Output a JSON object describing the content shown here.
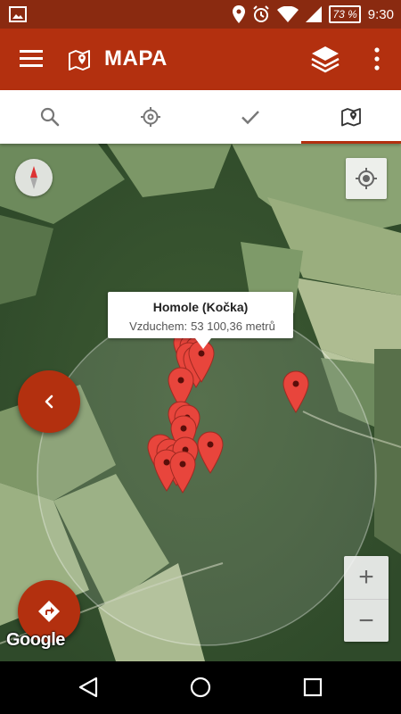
{
  "statusbar": {
    "battery": "73 %",
    "time": "9:30",
    "icons": [
      "image-icon",
      "location-icon",
      "alarm-icon",
      "wifi-icon",
      "signal-icon"
    ]
  },
  "appbar": {
    "title": "MAPA",
    "icons": [
      "menu-icon",
      "map-icon",
      "layers-icon",
      "more-icon"
    ]
  },
  "tabs": [
    {
      "icon": "search-icon",
      "active": false
    },
    {
      "icon": "crosshair-icon",
      "active": false
    },
    {
      "icon": "check-icon",
      "active": false
    },
    {
      "icon": "map-icon",
      "active": true
    }
  ],
  "map": {
    "info_window": {
      "title": "Homole (Kočka)",
      "label": "Vzduchem:",
      "distance": "53 100,36 metrů"
    },
    "attribution": "Google",
    "zoom_in": "+",
    "zoom_out": "−",
    "marker_color": "#e8453c",
    "markers_count": 18
  },
  "colors": {
    "accent": "#b3300f",
    "statusbar": "#8a2a10"
  }
}
